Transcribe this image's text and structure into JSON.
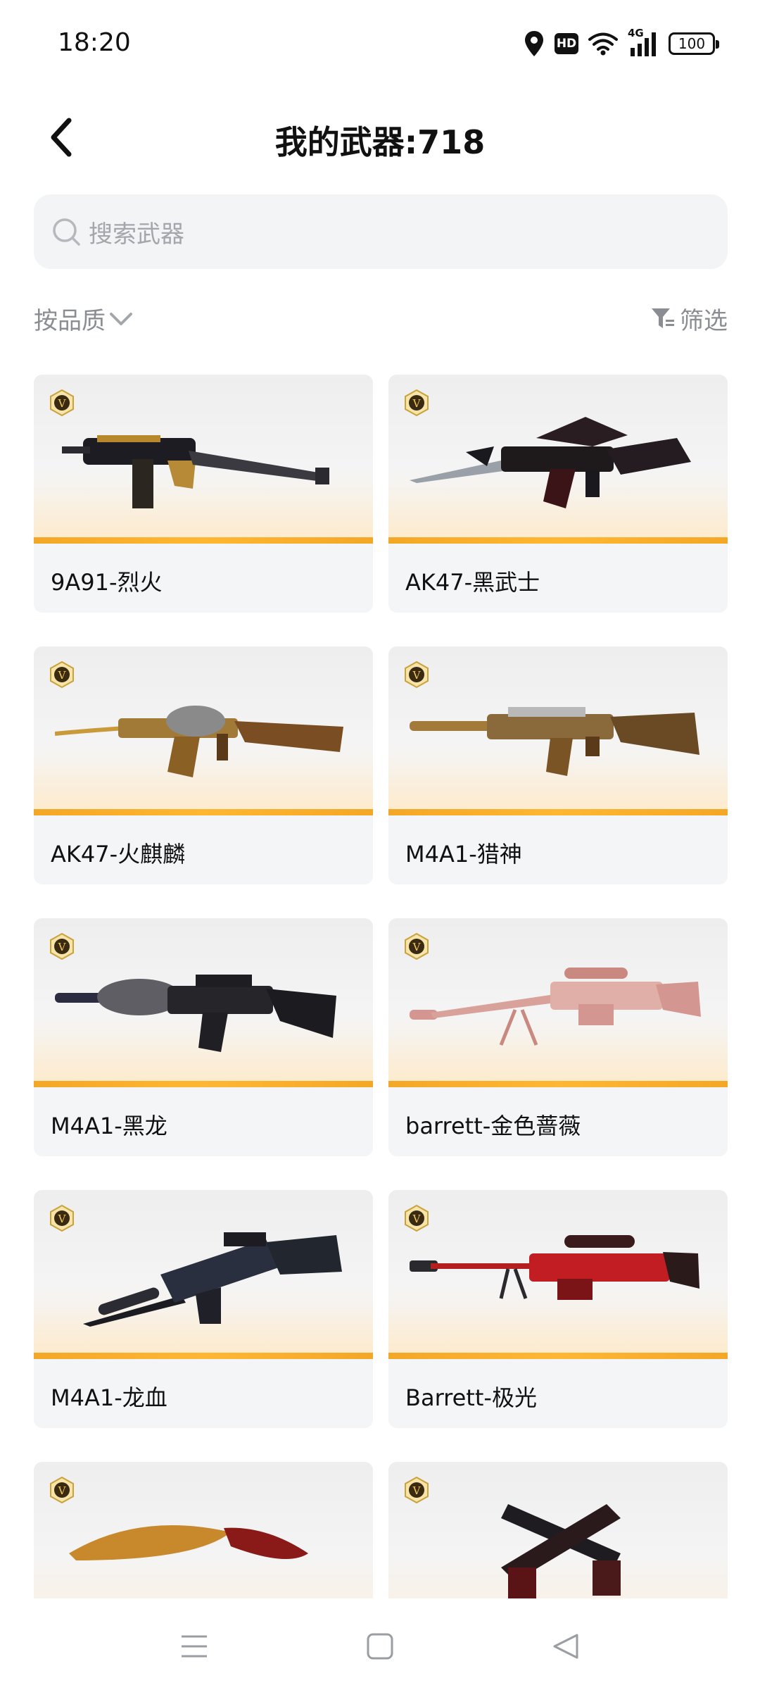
{
  "status_bar": {
    "time": "18:20",
    "hd_label": "HD",
    "network_label": "4G",
    "battery": "100"
  },
  "header": {
    "title": "我的武器:718",
    "back_icon": "chevron-left-icon"
  },
  "search": {
    "placeholder": "搜索武器"
  },
  "sort": {
    "label": "按品质"
  },
  "filter": {
    "label": "筛选"
  },
  "colors": {
    "accent_orange": "#f3a726",
    "card_bg": "#f4f5f7",
    "muted_text": "#8a8d92"
  },
  "weapons": [
    {
      "name": "9A91-烈火",
      "badge": "V"
    },
    {
      "name": "AK47-黑武士",
      "badge": "V"
    },
    {
      "name": "AK47-火麒麟",
      "badge": "V"
    },
    {
      "name": "M4A1-猎神",
      "badge": "V"
    },
    {
      "name": "M4A1-黑龙",
      "badge": "V"
    },
    {
      "name": "barrett-金色蔷薇",
      "badge": "V"
    },
    {
      "name": "M4A1-龙血",
      "badge": "V"
    },
    {
      "name": "Barrett-极光",
      "badge": "V"
    },
    {
      "name": "",
      "badge": "V"
    },
    {
      "name": "",
      "badge": "V"
    }
  ],
  "nav": {
    "menu_icon": "menu-icon",
    "home_icon": "home-square-icon",
    "back_icon": "back-triangle-icon"
  }
}
